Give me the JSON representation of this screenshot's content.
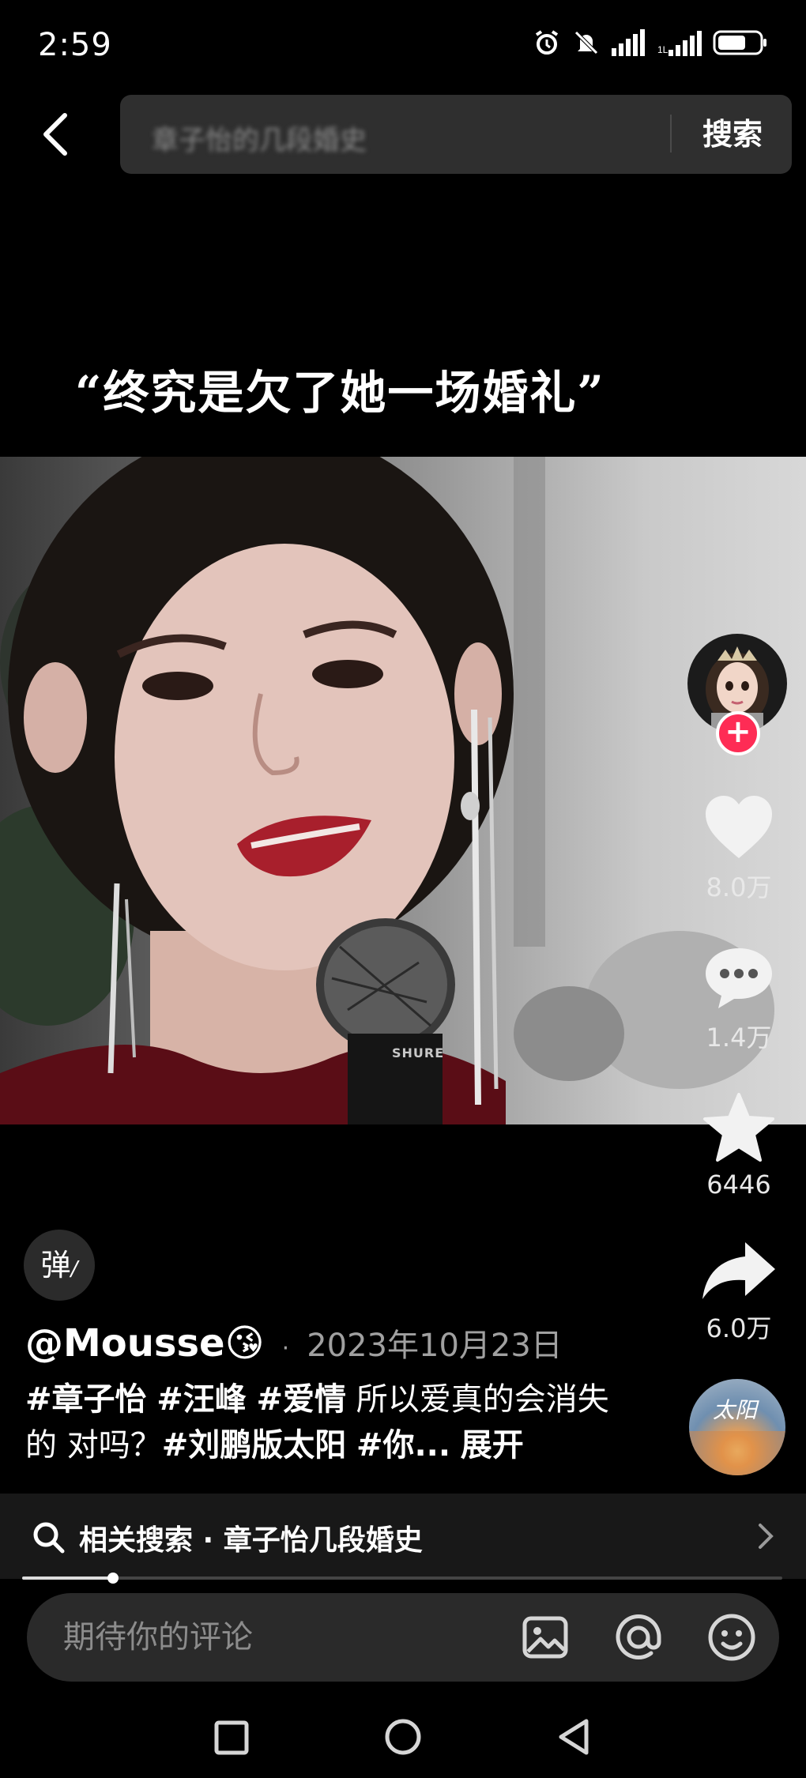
{
  "status_bar": {
    "time": "2:59",
    "icons": [
      "alarm-icon",
      "mute-icon",
      "signal-icon",
      "signal-2-icon",
      "battery-icon"
    ]
  },
  "search": {
    "query": "章子怡的几段婚史",
    "button_label": "搜索"
  },
  "video": {
    "caption": "“终究是欠了她一场婚礼”",
    "mic_brand": "SHURE"
  },
  "actions": {
    "like_count": "8.0万",
    "comment_count": "1.4万",
    "favorite_count": "6446",
    "share_count": "6.0万"
  },
  "post": {
    "danmu_label": "弹",
    "author": "@Mousse😘",
    "date_separator": "·",
    "date": "2023年10月23日",
    "tag1": "#章子怡",
    "tag2": "#汪峰",
    "tag3": "#爱情",
    "text1": " 所以爱真的会消失的 对吗？",
    "tag4": "#刘鹏版太阳",
    "tag5": "#你...",
    "expand": "展开"
  },
  "music": {
    "disc_text": "太阳"
  },
  "related": {
    "label": "相关搜索 · 章子怡几段婚史"
  },
  "progress": {
    "played_fraction": 0.12
  },
  "comment": {
    "placeholder": "期待你的评论"
  },
  "colors": {
    "accent": "#fe2c55",
    "background": "#000000",
    "search_bg": "#2f2f2f",
    "comment_bg": "#2a2a2a"
  }
}
